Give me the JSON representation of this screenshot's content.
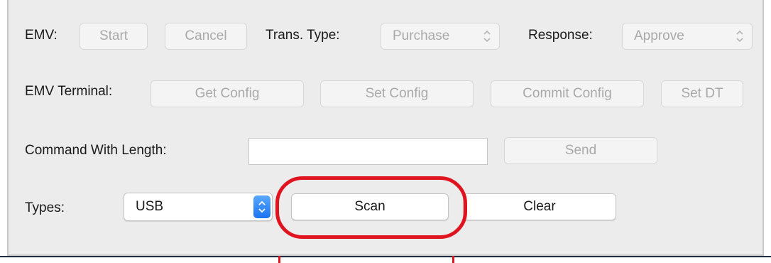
{
  "emv": {
    "label": "EMV:",
    "start": "Start",
    "cancel": "Cancel",
    "trans_type_label": "Trans. Type:",
    "trans_type_value": "Purchase",
    "response_label": "Response:",
    "response_value": "Approve"
  },
  "emv_terminal": {
    "label": "EMV Terminal:",
    "get_config": "Get Config",
    "set_config": "Set Config",
    "commit_config": "Commit Config",
    "set_dt": "Set DT"
  },
  "command": {
    "label": "Command With Length:",
    "value": "",
    "send": "Send"
  },
  "types": {
    "label": "Types:",
    "selected": "USB",
    "scan": "Scan",
    "clear": "Clear"
  },
  "colors": {
    "panel_bg": "#ececec",
    "highlight": "#e0141e",
    "stepper_blue": "#1a73f0"
  },
  "icons": {
    "select_chevron": "chevron-up-down-icon",
    "stepper": "blue-stepper-icon"
  }
}
